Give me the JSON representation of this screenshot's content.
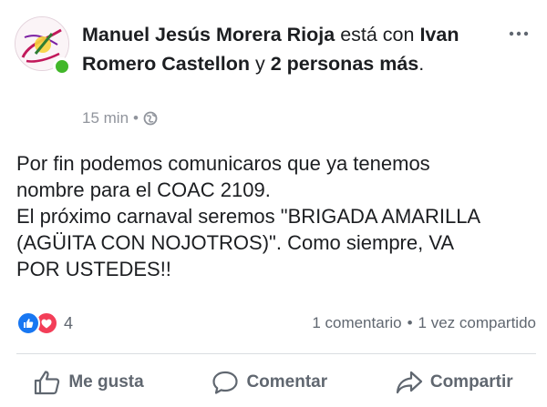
{
  "post": {
    "author": "Manuel Jesús Morera Rioja",
    "with_text": "está con",
    "tagged": "Ivan Romero Castellon",
    "and_text": "y",
    "others": "2 personas más",
    "period": ".",
    "time": "15 min",
    "dot": "•",
    "privacy_icon": "globe-icon",
    "message_lines": [
      "Por fin podemos comunicaros que ya tenemos",
      "nombre para el COAC 2109.",
      "El próximo carnaval seremos \"BRIGADA AMARILLA",
      "(AGÜITA CON NOJOTROS)\". Como siempre, VA",
      "POR USTEDES!!"
    ]
  },
  "stats": {
    "reaction_icons": [
      "like-icon",
      "love-icon"
    ],
    "reaction_count": "4",
    "comments": "1 comentario",
    "separator": "•",
    "shares": "1 vez compartido"
  },
  "actions": {
    "like": "Me gusta",
    "comment": "Comentar",
    "share": "Compartir"
  },
  "colors": {
    "like_blue": "#1877f2",
    "love_red": "#f33e58",
    "online_green": "#42b72a",
    "text_primary": "#1c1e21",
    "text_secondary": "#606770"
  }
}
